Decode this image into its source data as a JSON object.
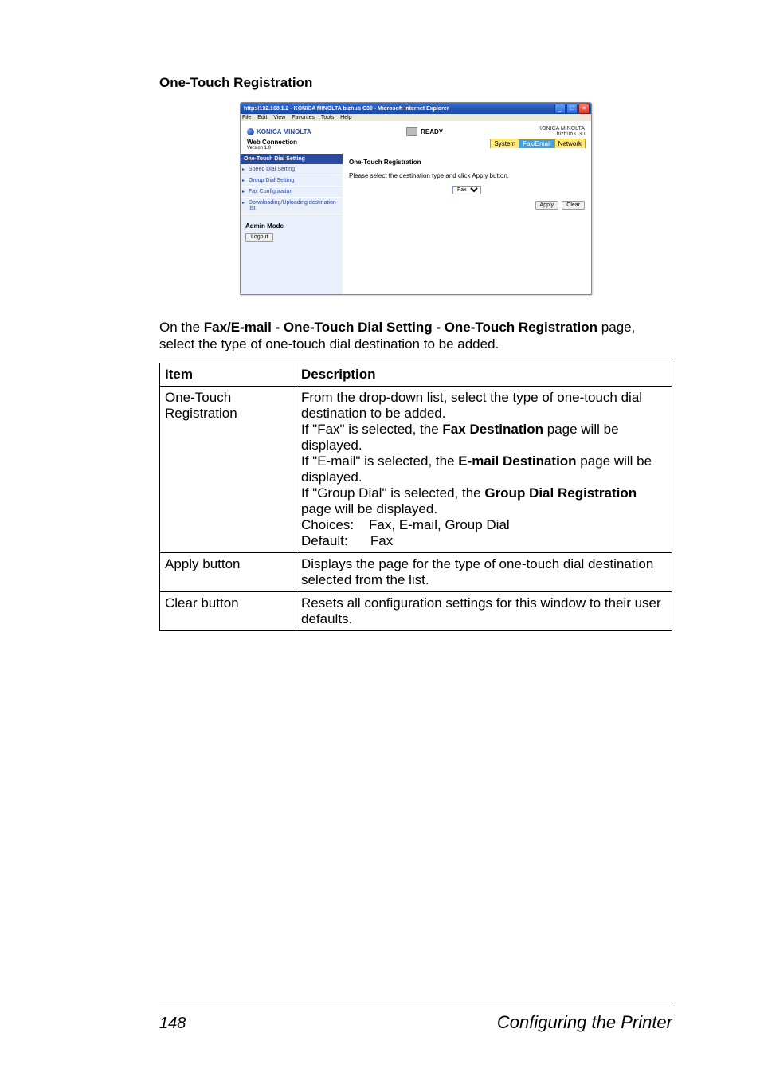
{
  "section_title": "One-Touch Registration",
  "browser": {
    "window_title": "http://192.168.1.2 - KONICA MINOLTA bizhub C30 - Microsoft Internet Explorer",
    "menu": {
      "file": "File",
      "edit": "Edit",
      "view": "View",
      "favorites": "Favorites",
      "tools": "Tools",
      "help": "Help"
    },
    "brand_name": "KONICA MINOLTA",
    "status_text": "READY",
    "corner_brand": "KONICA MINOLTA",
    "corner_model": "bizhub C30",
    "web_connection_label": "Web Connection",
    "version_label": "Version 1.0",
    "tabs": {
      "system": "System",
      "fax": "Fax/Email",
      "network": "Network"
    },
    "sidebar": {
      "header": "One-Touch Dial Setting",
      "items": [
        "Speed Dial Setting",
        "Group Dial Setting",
        "Fax Configuration",
        "Downloading/Uploading destination list"
      ]
    },
    "admin_mode_label": "Admin Mode",
    "logout_label": "Logout",
    "main": {
      "title": "One-Touch Registration",
      "instruction": "Please select the destination type and click Apply button.",
      "select_value": "Fax",
      "apply": "Apply",
      "clear": "Clear"
    }
  },
  "para_pre": "On the ",
  "para_bold": "Fax/E-mail - One-Touch Dial Setting - One-Touch Registration",
  "para_post": " page, select the type of one-touch dial destination to be added.",
  "table": {
    "head_item": "Item",
    "head_desc": "Description",
    "row1_item": "One-Touch Registration",
    "row1": {
      "l1": "From the drop-down list, select the type of one-touch dial destination to be added.",
      "l2a": "If \"Fax\" is selected, the ",
      "l2b": "Fax Destination",
      "l2c": " page will be displayed.",
      "l3a": "If \"E-mail\" is selected, the ",
      "l3b": "E-mail Destination",
      "l3c": " page will be displayed.",
      "l4a": "If \"Group Dial\" is selected, the ",
      "l4b": "Group Dial Registration",
      "l4c": " page will be displayed.",
      "l5": "Choices:    Fax, E-mail, Group Dial",
      "l6": "Default:      Fax"
    },
    "row2_item": "Apply button",
    "row2_desc": "Displays the page for the type of one-touch dial destination selected from the list.",
    "row3_item": "Clear button",
    "row3_desc": "Resets all configuration settings for this window to their user defaults."
  },
  "footer": {
    "page": "148",
    "chapter": "Configuring the Printer"
  }
}
